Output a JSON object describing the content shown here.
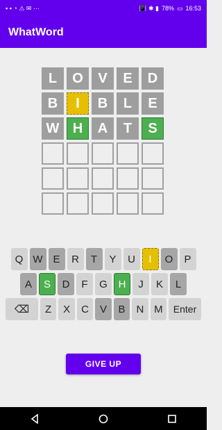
{
  "status": {
    "right_text": "78%",
    "time": "16:53"
  },
  "app": {
    "title": "WhatWord"
  },
  "board": [
    [
      {
        "l": "L",
        "s": "absent"
      },
      {
        "l": "O",
        "s": "absent"
      },
      {
        "l": "V",
        "s": "absent"
      },
      {
        "l": "E",
        "s": "absent"
      },
      {
        "l": "D",
        "s": "absent"
      }
    ],
    [
      {
        "l": "B",
        "s": "absent"
      },
      {
        "l": "I",
        "s": "present"
      },
      {
        "l": "B",
        "s": "absent"
      },
      {
        "l": "L",
        "s": "absent"
      },
      {
        "l": "E",
        "s": "absent"
      }
    ],
    [
      {
        "l": "W",
        "s": "absent"
      },
      {
        "l": "H",
        "s": "correct"
      },
      {
        "l": "A",
        "s": "absent"
      },
      {
        "l": "T",
        "s": "absent"
      },
      {
        "l": "S",
        "s": "correct"
      }
    ],
    [
      {
        "l": "",
        "s": "empty"
      },
      {
        "l": "",
        "s": "empty"
      },
      {
        "l": "",
        "s": "empty"
      },
      {
        "l": "",
        "s": "empty"
      },
      {
        "l": "",
        "s": "empty"
      }
    ],
    [
      {
        "l": "",
        "s": "empty"
      },
      {
        "l": "",
        "s": "empty"
      },
      {
        "l": "",
        "s": "empty"
      },
      {
        "l": "",
        "s": "empty"
      },
      {
        "l": "",
        "s": "empty"
      }
    ],
    [
      {
        "l": "",
        "s": "empty"
      },
      {
        "l": "",
        "s": "empty"
      },
      {
        "l": "",
        "s": "empty"
      },
      {
        "l": "",
        "s": "empty"
      },
      {
        "l": "",
        "s": "empty"
      }
    ]
  ],
  "keyboard": [
    [
      {
        "k": "Q",
        "s": "normal"
      },
      {
        "k": "W",
        "s": "absent"
      },
      {
        "k": "E",
        "s": "absent"
      },
      {
        "k": "R",
        "s": "normal"
      },
      {
        "k": "T",
        "s": "absent"
      },
      {
        "k": "Y",
        "s": "normal"
      },
      {
        "k": "U",
        "s": "normal"
      },
      {
        "k": "I",
        "s": "present"
      },
      {
        "k": "O",
        "s": "absent"
      },
      {
        "k": "P",
        "s": "normal"
      }
    ],
    [
      {
        "k": "A",
        "s": "absent"
      },
      {
        "k": "S",
        "s": "correct"
      },
      {
        "k": "D",
        "s": "absent"
      },
      {
        "k": "F",
        "s": "normal"
      },
      {
        "k": "G",
        "s": "normal"
      },
      {
        "k": "H",
        "s": "correct"
      },
      {
        "k": "J",
        "s": "normal"
      },
      {
        "k": "K",
        "s": "normal"
      },
      {
        "k": "L",
        "s": "absent"
      }
    ],
    [
      {
        "k": "⌫",
        "s": "back"
      },
      {
        "k": "Z",
        "s": "normal"
      },
      {
        "k": "X",
        "s": "normal"
      },
      {
        "k": "C",
        "s": "normal"
      },
      {
        "k": "V",
        "s": "absent"
      },
      {
        "k": "B",
        "s": "absent"
      },
      {
        "k": "N",
        "s": "normal"
      },
      {
        "k": "M",
        "s": "normal"
      },
      {
        "k": "Enter",
        "s": "wide"
      }
    ]
  ],
  "give_up_label": "GIVE UP",
  "colors": {
    "primary": "#6200ee",
    "correct": "#4caf50",
    "present": "#e6c000",
    "absent": "#9e9e9e"
  },
  "nav_icons": [
    "back-triangle-icon",
    "home-circle-icon",
    "recents-square-icon"
  ]
}
